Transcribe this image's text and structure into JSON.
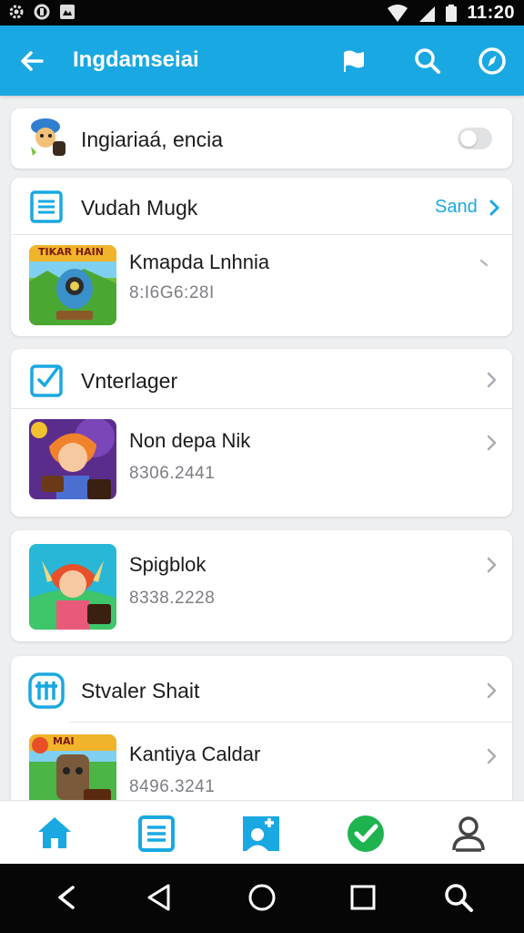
{
  "status_bar": {
    "time": "11:20"
  },
  "app_bar": {
    "title": "Ingdamseiai"
  },
  "toggle_row": {
    "label": "Ingiariaá, encia",
    "enabled": false
  },
  "section_1": {
    "header": "Vudah Mugk",
    "link": "Sand",
    "items": [
      {
        "title": "Kmapda Lnhnia",
        "subtitle": "8:I6G6:28I",
        "badge": "TIKAR HAIN"
      }
    ]
  },
  "section_2": {
    "header": "Vnterlager",
    "items": [
      {
        "title": "Non depa Nik",
        "subtitle": "8306.2441"
      }
    ]
  },
  "section_3": {
    "items": [
      {
        "title": "Spigblok",
        "subtitle": "8338.2228"
      }
    ]
  },
  "section_4": {
    "header": "Stvaler Shait",
    "items": [
      {
        "title": "Kantiya Caldar",
        "subtitle": "8496.3241",
        "badge": "MAI"
      }
    ]
  },
  "bottom_nav": {
    "items": [
      {
        "icon": "home-icon",
        "active": true
      },
      {
        "icon": "list-icon"
      },
      {
        "icon": "add-contact-icon"
      },
      {
        "icon": "check-badge-icon"
      },
      {
        "icon": "profile-icon"
      }
    ]
  },
  "colors": {
    "primary": "#19a8e2",
    "success": "#1fb34f",
    "background": "#eeeff1"
  }
}
